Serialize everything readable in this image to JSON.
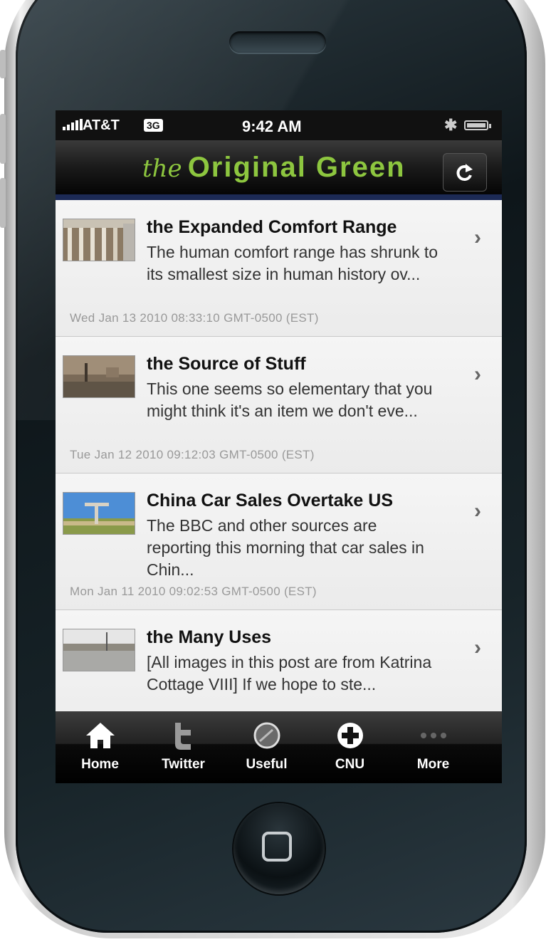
{
  "status_bar": {
    "carrier": "AT&T",
    "network": "3G",
    "time": "9:42 AM"
  },
  "nav_bar": {
    "title_prefix": "the",
    "title_main": "Original Green",
    "title_color": "#8dc63f",
    "refresh_icon": "refresh-icon"
  },
  "feed": [
    {
      "title": "the Expanded Comfort Range",
      "excerpt": "The human comfort range has shrunk to its smallest size in human history ov...",
      "date": "Wed Jan 13 2010 08:33:10 GMT-0500 (EST)"
    },
    {
      "title": "the Source of Stuff",
      "excerpt": "This one seems so elementary that you might think it's an item we don't eve...",
      "date": "Tue Jan 12 2010 09:12:03 GMT-0500 (EST)"
    },
    {
      "title": "China Car Sales Overtake US",
      "excerpt": "The BBC and other sources are reporting this morning that car sales in Chin...",
      "date": "Mon Jan 11 2010 09:02:53 GMT-0500 (EST)"
    },
    {
      "title": "the Many Uses",
      "excerpt": "[All images in this post are from Katrina Cottage VIII] If we hope to ste...",
      "date": ""
    }
  ],
  "tab_bar": {
    "items": [
      {
        "label": "Home",
        "icon": "home-icon"
      },
      {
        "label": "Twitter",
        "icon": "twitter-icon"
      },
      {
        "label": "Useful",
        "icon": "globe-icon"
      },
      {
        "label": "CNU",
        "icon": "plus-icon"
      },
      {
        "label": "More",
        "icon": "more-icon"
      }
    ]
  }
}
